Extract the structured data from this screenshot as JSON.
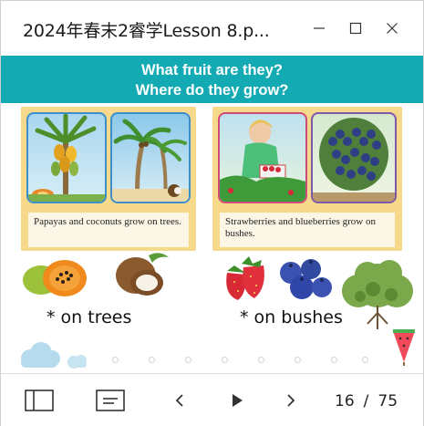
{
  "window": {
    "title": "2024年春末2睿学Lesson 8.p..."
  },
  "slide": {
    "banner_line1": "What fruit are they?",
    "banner_line2": "Where do they grow?",
    "caption_left": "Papayas and coconuts grow on trees.",
    "caption_right": "Strawberries and blueberries grow on bushes.",
    "label_trees": "* on trees",
    "label_bushes": "* on bushes"
  },
  "toolbar": {
    "current_page": "16",
    "separator": "/",
    "total_pages": "75"
  },
  "colors": {
    "banner": "#14aab4",
    "panel": "#f7d98c"
  },
  "icons": [
    "minimize-icon",
    "maximize-icon",
    "close-icon",
    "sidebar-icon",
    "notes-icon",
    "previous-icon",
    "play-icon",
    "next-icon"
  ]
}
